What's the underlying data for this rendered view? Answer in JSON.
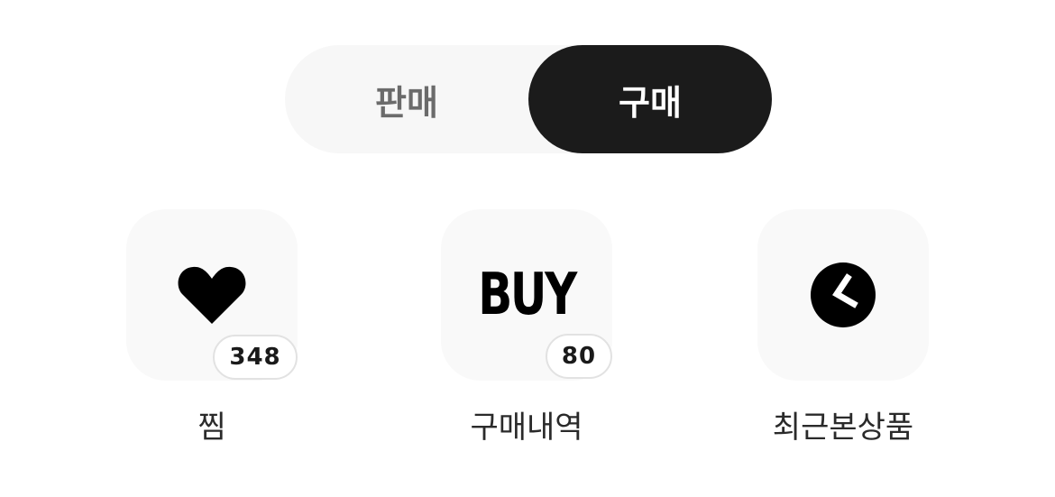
{
  "toggle": {
    "sell_label": "판매",
    "buy_label": "구매",
    "selected": "구매"
  },
  "shortcuts": [
    {
      "label": "찜",
      "icon": "heart-icon",
      "badge": "348"
    },
    {
      "label": "구매내역",
      "icon": "buy-icon",
      "icon_text": "BUY",
      "badge": "80"
    },
    {
      "label": "최근본상품",
      "icon": "clock-icon"
    }
  ],
  "colors": {
    "selected_bg": "#1b1b1b",
    "selected_text": "#ffffff",
    "unselected_text": "#6b6b6b",
    "track_bg": "#f7f7f7",
    "tile_bg": "#f9f9f9"
  }
}
